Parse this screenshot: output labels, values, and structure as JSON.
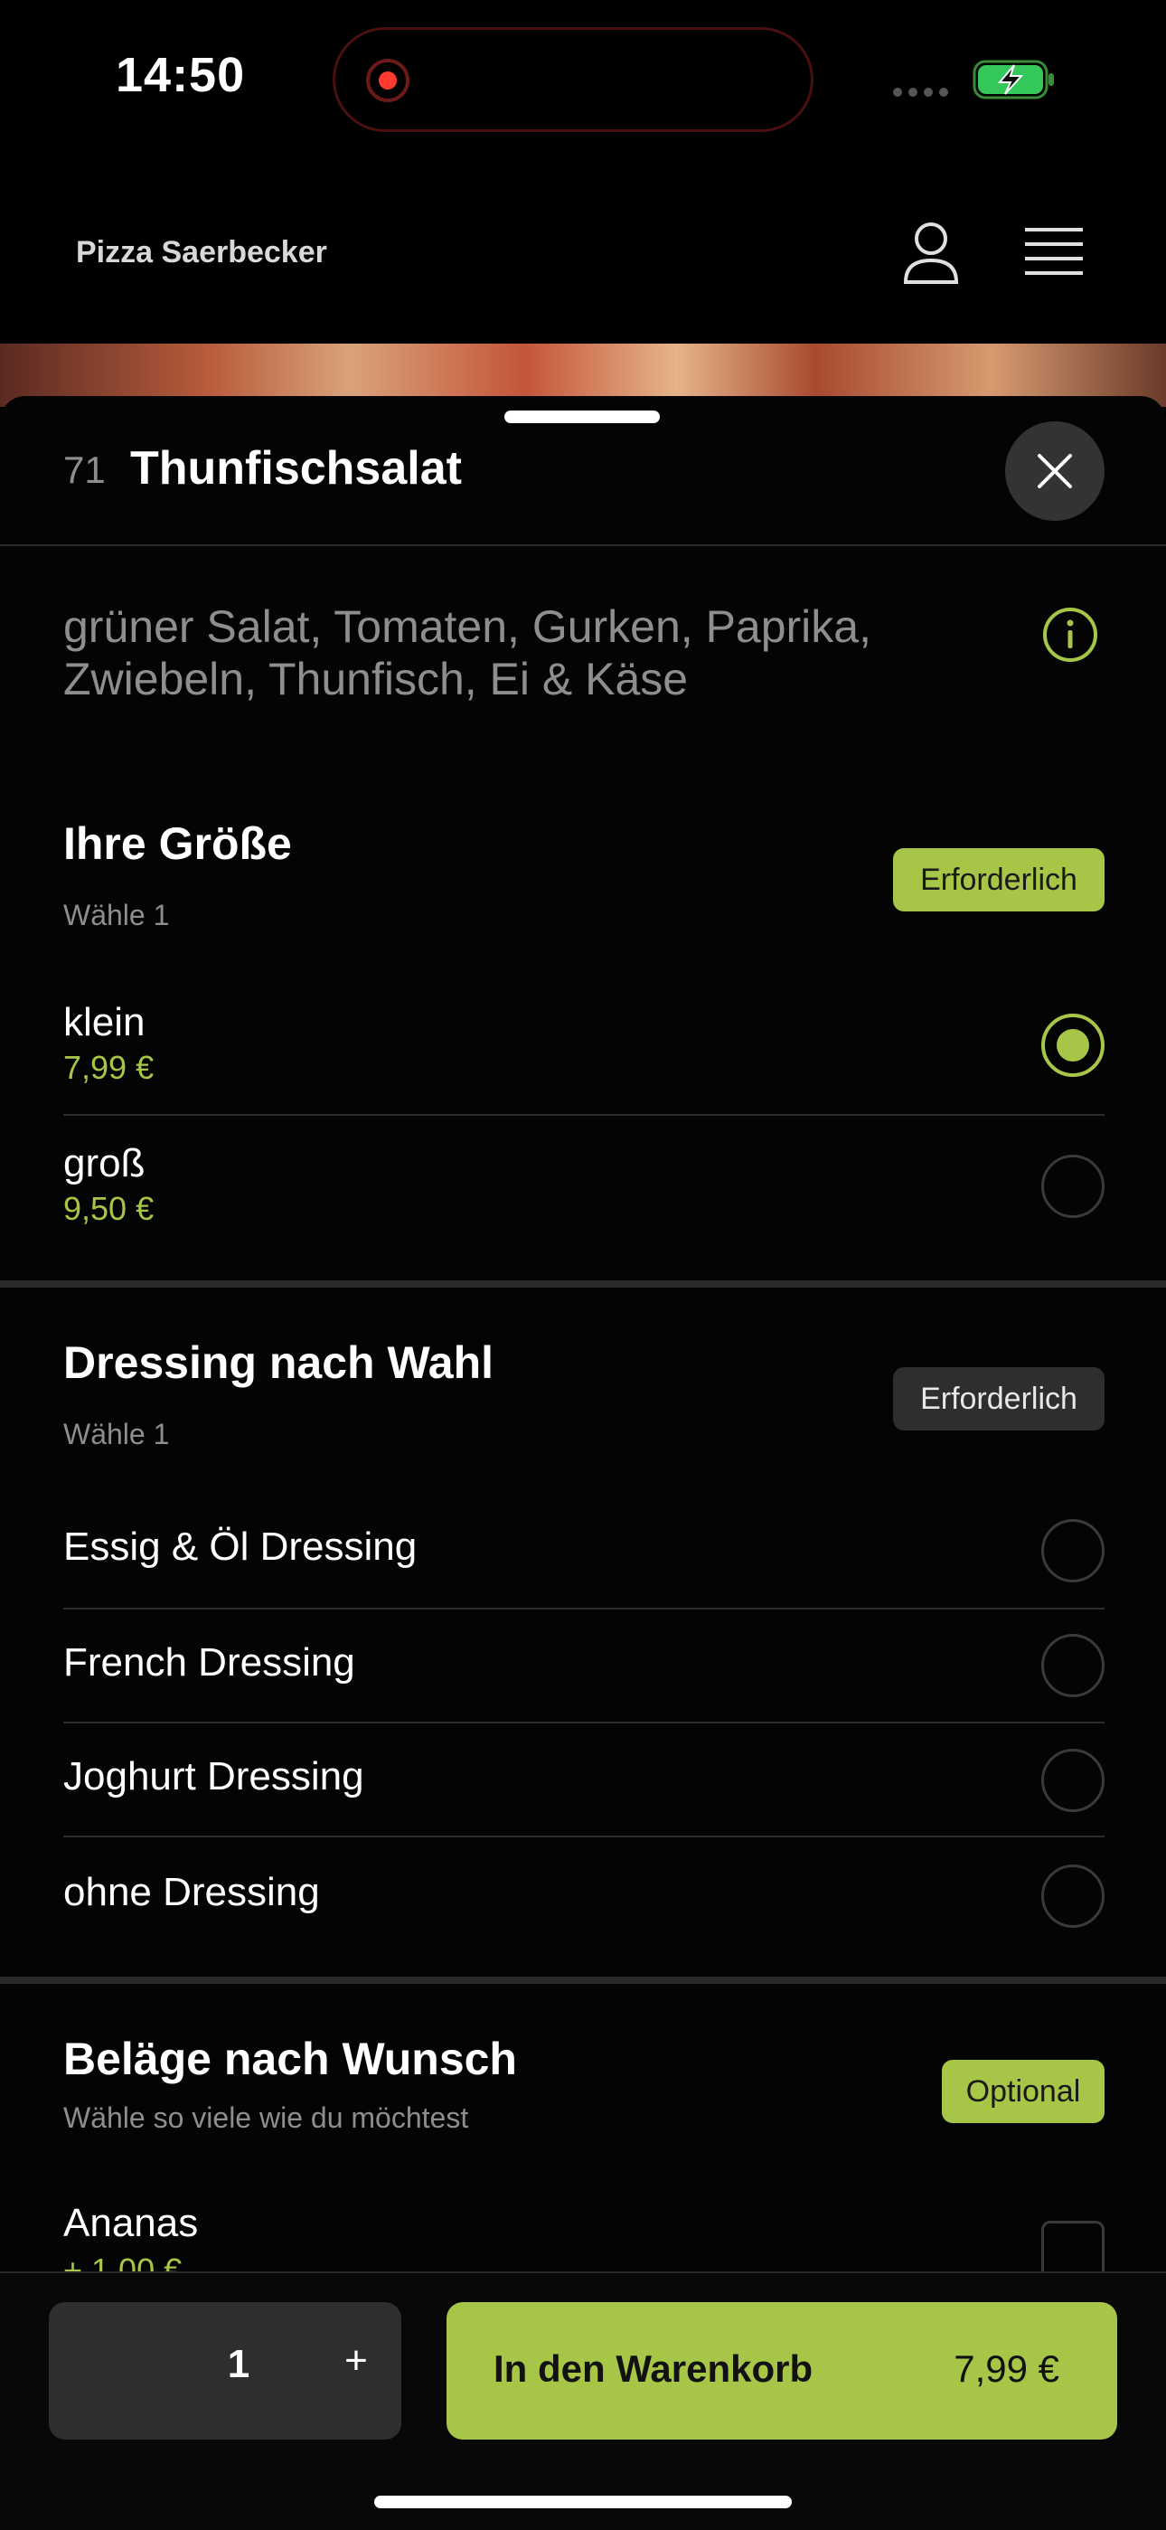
{
  "status": {
    "time": "14:50"
  },
  "header": {
    "brand": "Pizza Saerbecker"
  },
  "product": {
    "number": "71",
    "title": "Thunfischsalat",
    "description": "grüner Salat, Tomaten, Gurken, Paprika, Zwiebeln, Thunfisch, Ei & Käse"
  },
  "groups": [
    {
      "title": "Ihre Größe",
      "subtitle": "Wähle 1",
      "badge": "Erforderlich",
      "options": [
        {
          "label": "klein",
          "price": "7,99 €",
          "selected": true
        },
        {
          "label": "groß",
          "price": "9,50 €",
          "selected": false
        }
      ]
    },
    {
      "title": "Dressing nach Wahl",
      "subtitle": "Wähle 1",
      "badge": "Erforderlich",
      "options": [
        {
          "label": "Essig & Öl Dressing"
        },
        {
          "label": "French Dressing"
        },
        {
          "label": "Joghurt Dressing"
        },
        {
          "label": "ohne Dressing"
        }
      ]
    },
    {
      "title": "Beläge nach Wunsch",
      "subtitle": "Wähle so viele wie du möchtest",
      "badge": "Optional",
      "options": [
        {
          "label": "Ananas",
          "price": "+ 1,00 €"
        }
      ]
    }
  ],
  "footer": {
    "quantity": "1",
    "plus": "+",
    "cart_label": "In den Warenkorb",
    "cart_price": "7,99 €"
  },
  "colors": {
    "accent": "#a7c648",
    "background": "#000000"
  }
}
